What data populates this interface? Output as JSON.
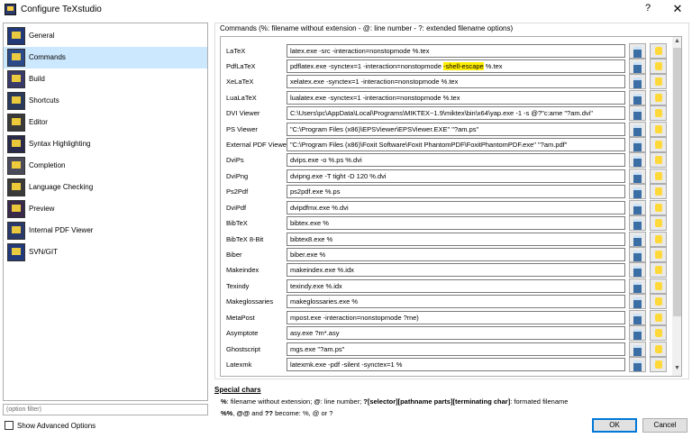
{
  "window": {
    "title": "Configure TeXstudio",
    "help": "?",
    "close": "✕"
  },
  "nav": {
    "items": [
      {
        "label": "General",
        "icon": "general-icon"
      },
      {
        "label": "Commands",
        "icon": "commands-icon",
        "active": true
      },
      {
        "label": "Build",
        "icon": "build-icon"
      },
      {
        "label": "Shortcuts",
        "icon": "shortcuts-icon"
      },
      {
        "label": "Editor",
        "icon": "editor-icon"
      },
      {
        "label": "Syntax Highlighting",
        "icon": "syntax-highlighting-icon"
      },
      {
        "label": "Completion",
        "icon": "completion-icon"
      },
      {
        "label": "Language Checking",
        "icon": "language-checking-icon"
      },
      {
        "label": "Preview",
        "icon": "preview-icon"
      },
      {
        "label": "Internal PDF Viewer",
        "icon": "internal-pdf-viewer-icon"
      },
      {
        "label": "SVN/GIT",
        "icon": "svn-git-icon"
      }
    ],
    "filter_placeholder": "(option filter)",
    "advanced_label": "Show Advanced Options"
  },
  "commands": {
    "header": "Commands (%: filename without extension - @: line number - ?: extended filename options)",
    "rows": [
      {
        "label": "LaTeX",
        "value": "latex.exe -src -interaction=nonstopmode %.tex"
      },
      {
        "label": "PdfLaTeX",
        "value_pre": "pdflatex.exe -synctex=1 -interaction=nonstopmode ",
        "value_hl": "-shell-escape",
        "value_post": " %.tex"
      },
      {
        "label": "XeLaTeX",
        "value": "xelatex.exe -synctex=1 -interaction=nonstopmode %.tex"
      },
      {
        "label": "LuaLaTeX",
        "value": "lualatex.exe -synctex=1 -interaction=nonstopmode %.tex"
      },
      {
        "label": "DVI Viewer",
        "value": "C:\\Users\\pc\\AppData\\Local\\Programs\\MIKTEX~1.9\\miktex\\bin\\x64\\yap.exe -1 -s @?\"c:ame \"?am.dvi\""
      },
      {
        "label": "PS Viewer",
        "value": "\"C:\\Program Files (x86)\\EPSViewer\\EPSViewer.EXE\" \"?am.ps\""
      },
      {
        "label": "External PDF Viewer",
        "value": "\"C:\\Program Files (x86)\\Foxit Software\\Foxit PhantomPDF\\FoxitPhantomPDF.exe\" \"?am.pdf\""
      },
      {
        "label": "DviPs",
        "value": "dvips.exe -o %.ps %.dvi"
      },
      {
        "label": "DviPng",
        "value": "dvipng.exe -T tight -D 120 %.dvi"
      },
      {
        "label": "Ps2Pdf",
        "value": "ps2pdf.exe %.ps"
      },
      {
        "label": "DviPdf",
        "value": "dvipdfmx.exe %.dvi"
      },
      {
        "label": "BibTeX",
        "value": "bibtex.exe %"
      },
      {
        "label": "BibTeX 8-Bit",
        "value": "bibtex8.exe %"
      },
      {
        "label": "Biber",
        "value": "biber.exe %"
      },
      {
        "label": "Makeindex",
        "value": "makeindex.exe %.idx"
      },
      {
        "label": "Texindy",
        "value": "texindy.exe %.idx"
      },
      {
        "label": "Makeglossaries",
        "value": "makeglossaries.exe %"
      },
      {
        "label": "MetaPost",
        "value": "mpost.exe -interaction=nonstopmode ?me)"
      },
      {
        "label": "Asymptote",
        "value": "asy.exe ?m*.asy"
      },
      {
        "label": "Ghostscript",
        "value": "mgs.exe \"?am.ps\""
      },
      {
        "label": "Latexmk",
        "value": "latexmk.exe -pdf -silent -synctex=1 %"
      }
    ],
    "scroll_up": "▲",
    "scroll_down": "▼"
  },
  "special": {
    "title": "Special chars",
    "l1_a": "%",
    "l1_b": ": filename without extension; ",
    "l1_c": "@",
    "l1_d": ": line number; ",
    "l1_e": "?[selector][pathname parts][terminating char]",
    "l1_f": ": formated filename",
    "l2_a": "%%",
    "l2_b": ", ",
    "l2_c": "@@",
    "l2_d": " and ",
    "l2_e": "??",
    "l2_f": " become: %, @ or ?"
  },
  "buttons": {
    "ok": "OK",
    "cancel": "Cancel"
  },
  "colors": {
    "accent": "#0078d7",
    "selection": "#cce8ff",
    "highlight": "#ffee00"
  }
}
